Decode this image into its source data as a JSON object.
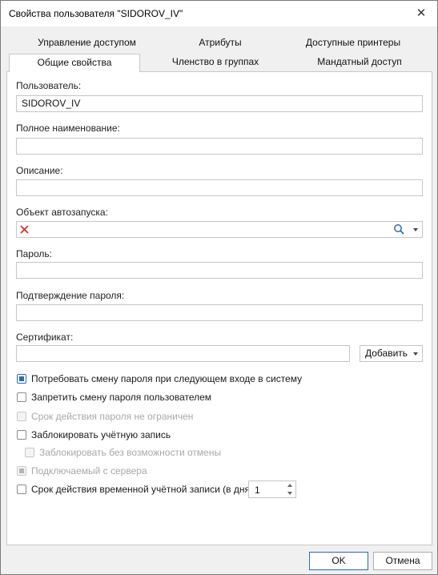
{
  "window": {
    "title": "Свойства пользователя \"SIDOROV_IV\"",
    "close_icon": "close-icon"
  },
  "tabs": {
    "row1": [
      "Управление доступом",
      "Атрибуты",
      "Доступные принтеры"
    ],
    "row2": [
      "Общие свойства",
      "Членство в группах",
      "Мандатный доступ"
    ],
    "active": "Общие свойства"
  },
  "form": {
    "user_label": "Пользователь:",
    "user_value": "SIDOROV_IV",
    "fullname_label": "Полное наименование:",
    "fullname_value": "",
    "description_label": "Описание:",
    "description_value": "",
    "autorun_label": "Объект автозапуска:",
    "autorun_value": "",
    "password_label": "Пароль:",
    "password_value": "",
    "confirm_label": "Подтверждение пароля:",
    "confirm_value": "",
    "certificate_label": "Сертификат:",
    "certificate_value": "",
    "add_button": "Добавить"
  },
  "options": [
    {
      "label": "Потребовать смену пароля при следующем входе в систему",
      "checked": true,
      "disabled": false
    },
    {
      "label": "Запретить смену пароля пользователем",
      "checked": false,
      "disabled": false
    },
    {
      "label": "Срок действия пароля не ограничен",
      "checked": false,
      "disabled": true
    },
    {
      "label": "Заблокировать учётную запись",
      "checked": false,
      "disabled": false
    },
    {
      "label": "Заблокировать без возможности отмены",
      "checked": false,
      "disabled": true
    },
    {
      "label": "Подключаемый с сервера",
      "checked": true,
      "disabled": true
    },
    {
      "label": "Срок действия временной учётной записи (в днях)",
      "checked": false,
      "disabled": false
    }
  ],
  "temp_days_value": "1",
  "buttons": {
    "ok": "OK",
    "cancel": "Отмена"
  },
  "colors": {
    "accent": "#2a6ab3",
    "clear_icon": "#d0342c"
  }
}
